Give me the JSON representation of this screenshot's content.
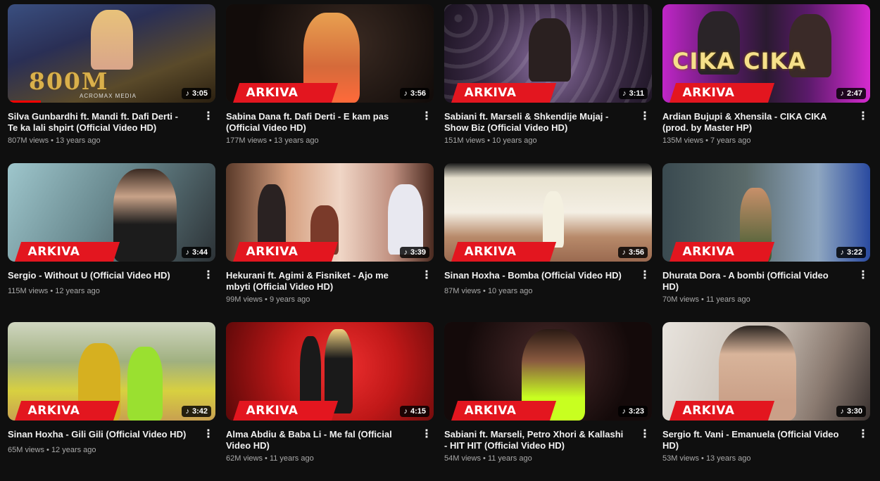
{
  "badge": "ARKIVA",
  "colors": {
    "badge_red": "#e3161f",
    "background": "#0f0f0f",
    "meta_gray": "#aaaaaa"
  },
  "videos": [
    {
      "title": "Silva Gunbardhi ft. Mandi ft. Dafi Derti - Te ka lali shpirt (Official Video HD)",
      "views": "807M views",
      "age": "13 years ago",
      "duration": "3:05",
      "logo_text": "800M",
      "logo_sub": "ACROMAX MEDIA",
      "progress": 0.16
    },
    {
      "title": "Sabina Dana ft. Dafi Derti - E kam pas (Official Video HD)",
      "views": "177M views",
      "age": "13 years ago",
      "duration": "3:56"
    },
    {
      "title": "Sabiani ft. Marseli & Shkendije Mujaj - Show Biz (Official Video HD)",
      "views": "151M views",
      "age": "10 years ago",
      "duration": "3:11"
    },
    {
      "title": "Ardian Bujupi & Xhensila - CIKA CIKA (prod. by Master HP)",
      "views": "135M views",
      "age": "7 years ago",
      "duration": "2:47",
      "logo_text": "CIKA CIKA"
    },
    {
      "title": "Sergio - Without U (Official Video HD)",
      "views": "115M views",
      "age": "12 years ago",
      "duration": "3:44"
    },
    {
      "title": "Hekurani ft. Agimi & Fisniket - Ajo me mbyti (Official Video HD)",
      "views": "99M views",
      "age": "9 years ago",
      "duration": "3:39"
    },
    {
      "title": "Sinan Hoxha - Bomba (Official Video HD)",
      "views": "87M views",
      "age": "10 years ago",
      "duration": "3:56"
    },
    {
      "title": "Dhurata Dora - A bombi (Official Video HD)",
      "views": "70M views",
      "age": "11 years ago",
      "duration": "3:22"
    },
    {
      "title": "Sinan Hoxha - Gili Gili (Official Video HD)",
      "views": "65M views",
      "age": "12 years ago",
      "duration": "3:42"
    },
    {
      "title": "Alma Abdiu & Baba Li - Me fal (Official Video HD)",
      "views": "62M views",
      "age": "11 years ago",
      "duration": "4:15"
    },
    {
      "title": "Sabiani ft. Marseli, Petro Xhori & Kallashi - HIT HIT (Official Video HD)",
      "views": "54M views",
      "age": "11 years ago",
      "duration": "3:23"
    },
    {
      "title": "Sergio ft. Vani - Emanuela (Official Video HD)",
      "views": "53M views",
      "age": "13 years ago",
      "duration": "3:30"
    }
  ]
}
